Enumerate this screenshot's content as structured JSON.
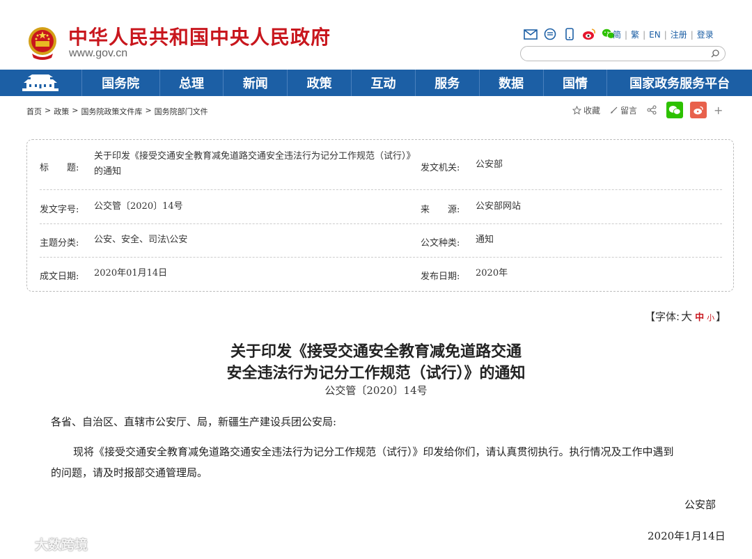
{
  "header": {
    "site_title": "中华人民共和国中央人民政府",
    "site_url": "www.gov.cn",
    "top_links": [
      "简",
      "繁",
      "EN",
      "注册",
      "登录"
    ],
    "search_placeholder": ""
  },
  "nav": {
    "items": [
      "国务院",
      "总理",
      "新闻",
      "政策",
      "互动",
      "服务",
      "数据",
      "国情",
      "国家政务服务平台"
    ]
  },
  "breadcrumb": [
    "首页",
    "政策",
    "国务院政策文件库",
    "国务院部门文件"
  ],
  "share": {
    "favorite_label": "收藏",
    "comment_label": "留言",
    "plus": "+"
  },
  "info": {
    "title_label": "标　　题:",
    "title_value": "关于印发《接受交通安全教育减免道路交通安全违法行为记分工作规范（试行）》的通知",
    "issuer_label": "发文机关:",
    "issuer_value": "公安部",
    "docno_label": "发文字号:",
    "docno_value": "公交管〔2020〕14号",
    "source_label": "来　　源:",
    "source_value": "公安部网站",
    "topic_label": "主题分类:",
    "topic_value": "公安、安全、司法\\公安",
    "type_label": "公文种类:",
    "type_value": "通知",
    "date_label": "成文日期:",
    "date_value": "2020年01月14日",
    "publish_label": "发布日期:",
    "publish_value": "2020年"
  },
  "font_control": {
    "prefix": "【字体:",
    "large": "大",
    "medium": "中",
    "small": "小",
    "suffix": "】"
  },
  "article": {
    "title_line1": "关于印发《接受交通安全教育减免道路交通",
    "title_line2": "安全违法行为记分工作规范（试行）》的通知",
    "doc_number": "公交管〔2020〕14号",
    "salutation": "各省、自治区、直辖市公安厅、局，新疆生产建设兵团公安局:",
    "body_line1": "现将《接受交通安全教育减免道路交通安全违法行为记分工作规范（试行）》印发给你们，请认真贯彻执行。执行情况及工作中遇到",
    "body_line2": "的问题，请及时报部交通管理局。",
    "signer": "公安部",
    "sign_date": "2020年1月14日"
  },
  "watermark": "大数跨境",
  "colors": {
    "brand_red": "#c8161d",
    "nav_blue": "#1c5fa5",
    "link_blue": "#1c5fa5",
    "wechat_green": "#2dc100",
    "weibo_red": "#e8614c"
  }
}
